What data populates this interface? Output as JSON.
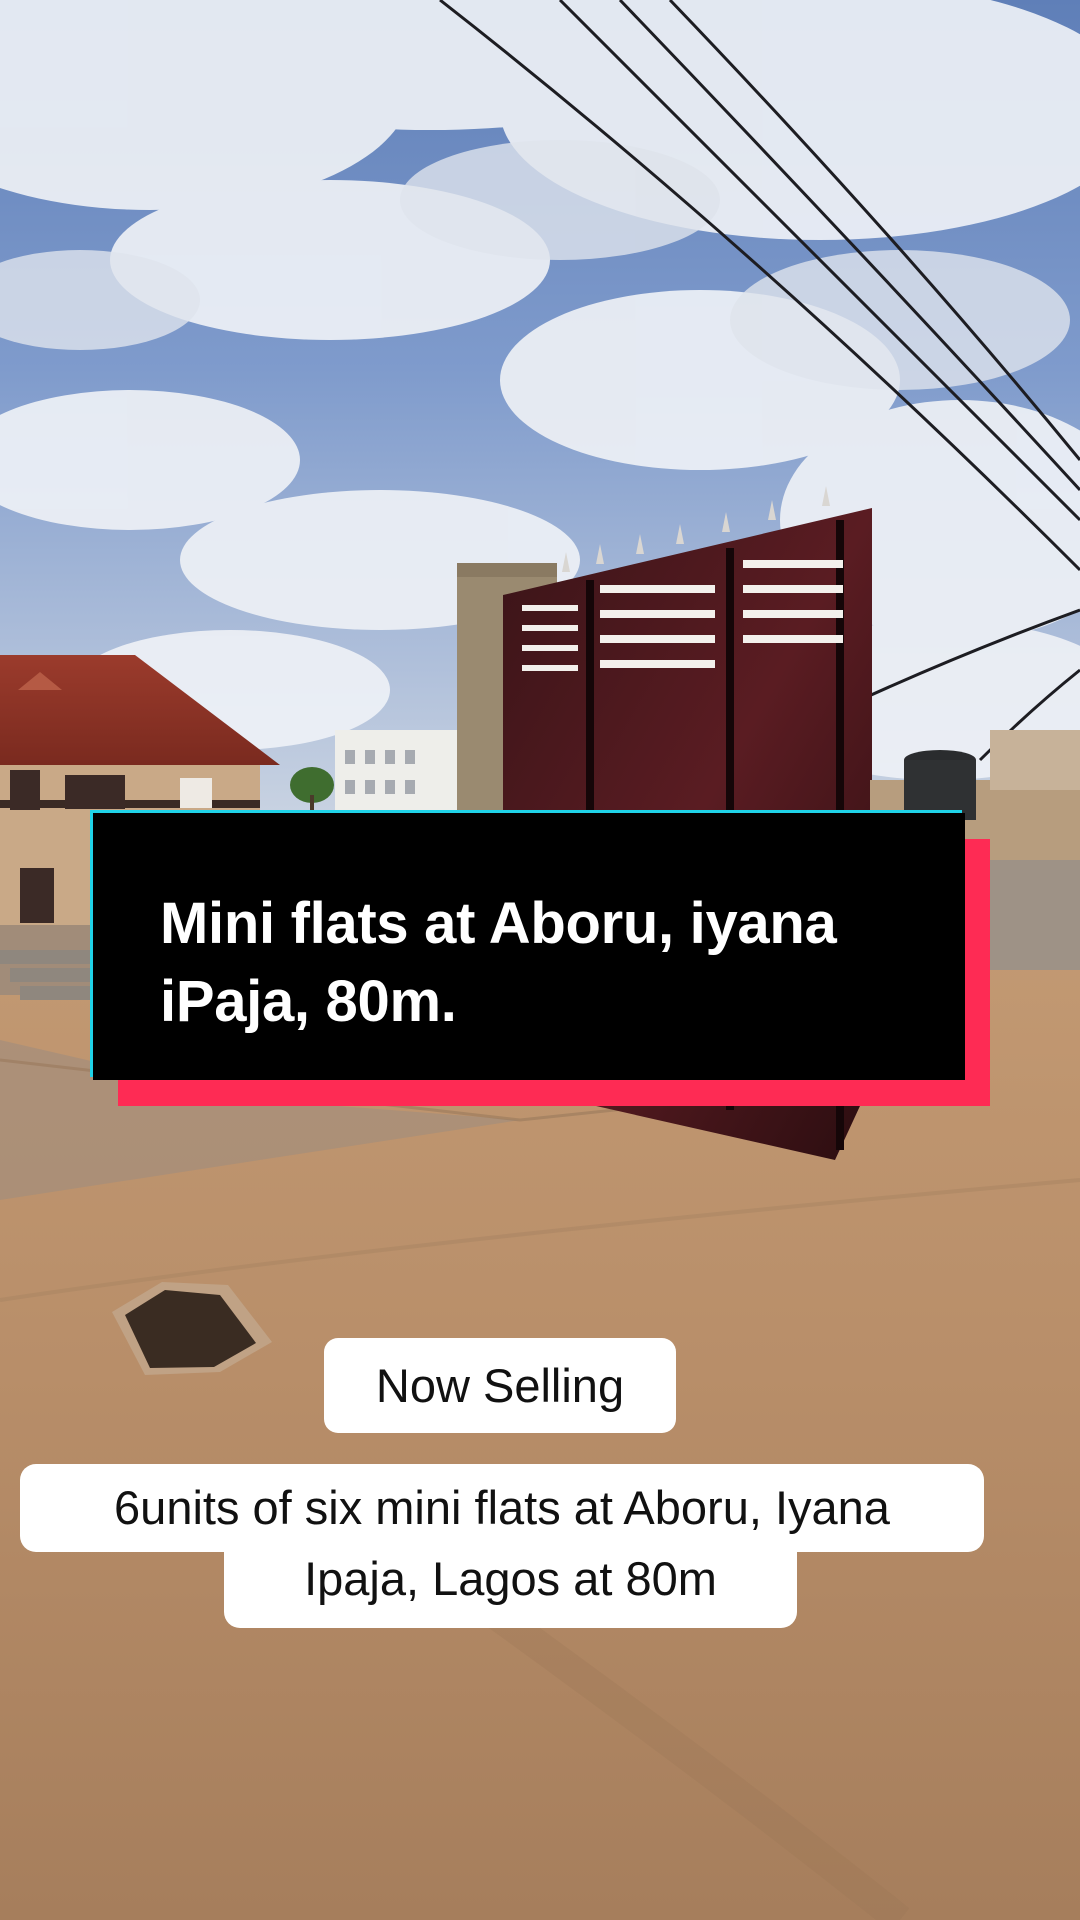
{
  "colors": {
    "title_card_background": "#000000",
    "title_card_accent_cyan": "#1fd3e8",
    "title_card_accent_red": "#fe2b54",
    "caption_background": "#ffffff"
  },
  "title_card": {
    "text": "Mini flats at Aboru, iyana iPaja, 80m."
  },
  "captions": {
    "status": "Now Selling",
    "description_line1": "6units of six mini flats at Aboru, Iyana",
    "description_line2": "Ipaja, Lagos at 80m"
  }
}
